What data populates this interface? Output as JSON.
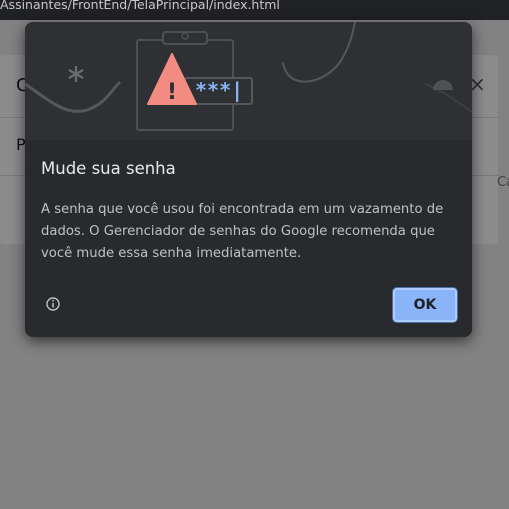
{
  "browser": {
    "url_path": "Assinantes/FrontEnd/TelaPrincipal/index.html"
  },
  "background_page": {
    "modal_header_letter": "C",
    "modal_row_letter": "P",
    "close_glyph": "×",
    "right_fragment": "Ca"
  },
  "dialog": {
    "title": "Mude sua senha",
    "body": "A senha que você usou foi encontrada em um vazamento de dados. O Gerenciador de senhas do Google recomenda que você mude essa senha imediatamente.",
    "ok_label": "OK",
    "password_mask": "***|",
    "warning_glyph": "!",
    "icons": {
      "illustration": "password-leak-illustration",
      "info": "info-icon",
      "warning": "warning-triangle-icon"
    },
    "colors": {
      "background": "#292a2d",
      "button": "#8ab4f8",
      "warning": "#f28b82",
      "mask": "#8ab4f8"
    }
  }
}
